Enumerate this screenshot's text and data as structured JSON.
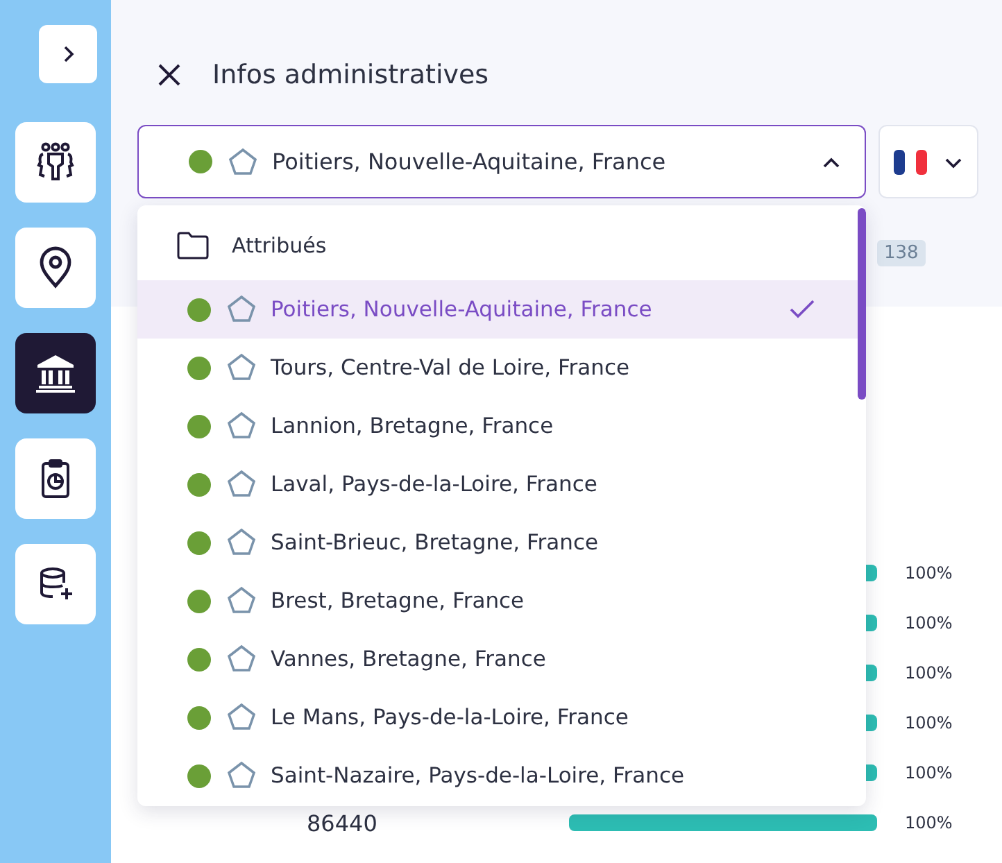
{
  "sidebar": {
    "items": [
      {
        "kind": "people",
        "selected": false
      },
      {
        "kind": "location",
        "selected": false
      },
      {
        "kind": "institution",
        "selected": true
      },
      {
        "kind": "report",
        "selected": false
      },
      {
        "kind": "database",
        "selected": false
      }
    ]
  },
  "header": {
    "title": "Infos administratives"
  },
  "selector": {
    "value": "Poitiers, Nouvelle-Aquitaine, France",
    "color": "#6a9f37",
    "expanded": true
  },
  "background": {
    "count": "138",
    "rows": [
      {
        "level": 1,
        "percent": "100%"
      },
      {
        "level": 1,
        "percent": "100%"
      },
      {
        "level": 1,
        "percent": "100%"
      },
      {
        "level": 1,
        "percent": "100%"
      },
      {
        "level": 1,
        "percent": "100%"
      },
      {
        "code": "86440",
        "level": 1,
        "percent": "100%"
      }
    ]
  },
  "dropdown": {
    "group": "Attribués",
    "items": [
      {
        "label": "Poitiers, Nouvelle-Aquitaine, France",
        "color": "#6a9f37",
        "selected": true
      },
      {
        "label": "Tours, Centre-Val de Loire, France",
        "color": "#6a9f37",
        "selected": false
      },
      {
        "label": "Lannion, Bretagne, France",
        "color": "#6a9f37",
        "selected": false
      },
      {
        "label": "Laval, Pays-de-la-Loire, France",
        "color": "#6a9f37",
        "selected": false
      },
      {
        "label": "Saint-Brieuc, Bretagne, France",
        "color": "#6a9f37",
        "selected": false
      },
      {
        "label": "Brest, Bretagne, France",
        "color": "#6a9f37",
        "selected": false
      },
      {
        "label": "Vannes, Bretagne, France",
        "color": "#6a9f37",
        "selected": false
      },
      {
        "label": "Le Mans, Pays-de-la-Loire, France",
        "color": "#6a9f37",
        "selected": false
      },
      {
        "label": "Saint-Nazaire, Pays-de-la-Loire, France",
        "color": "#6a9f37",
        "selected": false
      }
    ]
  }
}
